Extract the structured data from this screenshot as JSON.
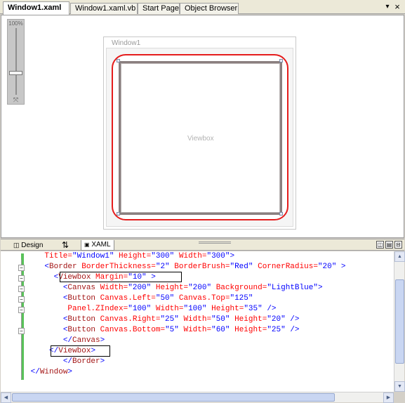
{
  "tabs": [
    {
      "label": "Window1.xaml",
      "active": true
    },
    {
      "label": "Window1.xaml.vb",
      "active": false
    },
    {
      "label": "Start Page",
      "active": false
    },
    {
      "label": "Object Browser",
      "active": false
    }
  ],
  "tab_controls": {
    "dropdown": "▾",
    "close": "×"
  },
  "designer": {
    "zoom_label": "100%",
    "zoom_level_percent": 100,
    "window_title": "Window1",
    "viewbox_label": "Viewbox",
    "colors": {
      "border_brush": "#e51c1c",
      "selection_handle": "#7c8ca8"
    }
  },
  "view_tabs": {
    "design": "Design",
    "swap": "⇅",
    "xaml": "XAML"
  },
  "pane_buttons": [
    "◫",
    "▤",
    "⊟"
  ],
  "code_lines": [
    [
      {
        "t": "    "
      },
      {
        "t": "Title=",
        "c": "a"
      },
      {
        "t": "\"Window1\"",
        "c": "b"
      },
      {
        "t": " Height=",
        "c": "a"
      },
      {
        "t": "\"300\"",
        "c": "b"
      },
      {
        "t": " Width=",
        "c": "a"
      },
      {
        "t": "\"300\"",
        "c": "b"
      },
      {
        "t": ">",
        "c": "b"
      }
    ],
    [
      {
        "t": "    "
      },
      {
        "t": "<",
        "c": "b"
      },
      {
        "t": "Border",
        "c": "r"
      },
      {
        "t": " BorderThickness=",
        "c": "a"
      },
      {
        "t": "\"2\"",
        "c": "b"
      },
      {
        "t": " BorderBrush=",
        "c": "a"
      },
      {
        "t": "\"Red\"",
        "c": "b"
      },
      {
        "t": " CornerRadius=",
        "c": "a"
      },
      {
        "t": "\"20\"",
        "c": "b"
      },
      {
        "t": " >",
        "c": "b"
      }
    ],
    [
      {
        "t": "      "
      },
      {
        "t": "<",
        "c": "b"
      },
      {
        "t": "Viewbox",
        "c": "r"
      },
      {
        "t": " Margin=",
        "c": "a"
      },
      {
        "t": "\"10\"",
        "c": "b"
      },
      {
        "t": " >",
        "c": "b"
      }
    ],
    [
      {
        "t": "        "
      },
      {
        "t": "<",
        "c": "b"
      },
      {
        "t": "Canvas",
        "c": "r"
      },
      {
        "t": " Width=",
        "c": "a"
      },
      {
        "t": "\"200\"",
        "c": "b"
      },
      {
        "t": " Height=",
        "c": "a"
      },
      {
        "t": "\"200\"",
        "c": "b"
      },
      {
        "t": " Background=",
        "c": "a"
      },
      {
        "t": "\"LightBlue\"",
        "c": "b"
      },
      {
        "t": ">",
        "c": "b"
      }
    ],
    [
      {
        "t": "        "
      },
      {
        "t": "<",
        "c": "b"
      },
      {
        "t": "Button",
        "c": "r"
      },
      {
        "t": " Canvas.Left=",
        "c": "a"
      },
      {
        "t": "\"50\"",
        "c": "b"
      },
      {
        "t": " Canvas.Top=",
        "c": "a"
      },
      {
        "t": "\"125\"",
        "c": "b"
      }
    ],
    [
      {
        "t": "         "
      },
      {
        "t": "Panel.ZIndex=",
        "c": "a"
      },
      {
        "t": "\"100\"",
        "c": "b"
      },
      {
        "t": " Width=",
        "c": "a"
      },
      {
        "t": "\"100\"",
        "c": "b"
      },
      {
        "t": " Height=",
        "c": "a"
      },
      {
        "t": "\"35\"",
        "c": "b"
      },
      {
        "t": " />",
        "c": "b"
      }
    ],
    [
      {
        "t": "        "
      },
      {
        "t": "<",
        "c": "b"
      },
      {
        "t": "Button",
        "c": "r"
      },
      {
        "t": " Canvas.Right=",
        "c": "a"
      },
      {
        "t": "\"25\"",
        "c": "b"
      },
      {
        "t": " Width=",
        "c": "a"
      },
      {
        "t": "\"50\"",
        "c": "b"
      },
      {
        "t": " Height=",
        "c": "a"
      },
      {
        "t": "\"20\"",
        "c": "b"
      },
      {
        "t": " />",
        "c": "b"
      }
    ],
    [
      {
        "t": "        "
      },
      {
        "t": "<",
        "c": "b"
      },
      {
        "t": "Button",
        "c": "r"
      },
      {
        "t": " Canvas.Bottom=",
        "c": "a"
      },
      {
        "t": "\"5\"",
        "c": "b"
      },
      {
        "t": " Width=",
        "c": "a"
      },
      {
        "t": "\"60\"",
        "c": "b"
      },
      {
        "t": " Height=",
        "c": "a"
      },
      {
        "t": "\"25\"",
        "c": "b"
      },
      {
        "t": " />",
        "c": "b"
      }
    ],
    [
      {
        "t": "        "
      },
      {
        "t": "</",
        "c": "b"
      },
      {
        "t": "Canvas",
        "c": "r"
      },
      {
        "t": ">",
        "c": "b"
      }
    ],
    [
      {
        "t": "     "
      },
      {
        "t": "</",
        "c": "b"
      },
      {
        "t": "Viewbox",
        "c": "r"
      },
      {
        "t": ">",
        "c": "b"
      }
    ],
    [
      {
        "t": "        "
      },
      {
        "t": "</",
        "c": "b"
      },
      {
        "t": "Border",
        "c": "r"
      },
      {
        "t": ">",
        "c": "b"
      }
    ],
    [
      {
        "t": " "
      },
      {
        "t": "</",
        "c": "b"
      },
      {
        "t": "Window",
        "c": "r"
      },
      {
        "t": ">",
        "c": "b"
      }
    ]
  ],
  "scrollbars": {
    "up": "▲",
    "down": "▼",
    "left": "◀",
    "right": "▶"
  }
}
